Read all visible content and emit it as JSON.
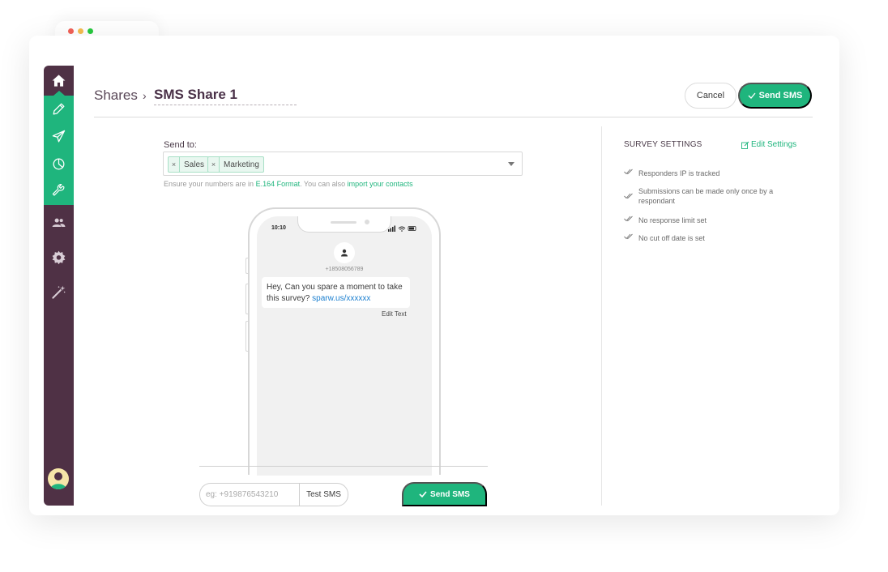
{
  "header": {
    "breadcrumb_root": "Shares",
    "breadcrumb_sep": "›",
    "title": "SMS Share 1",
    "cancel_label": "Cancel",
    "send_label": "Send SMS"
  },
  "sidebar": {
    "items": [
      {
        "name": "home",
        "icon": "home-icon"
      },
      {
        "name": "edit",
        "icon": "pencil-icon"
      },
      {
        "name": "share",
        "icon": "paper-plane-icon"
      },
      {
        "name": "reports",
        "icon": "pie-chart-icon"
      },
      {
        "name": "integrations",
        "icon": "wrench-icon"
      },
      {
        "name": "users",
        "icon": "users-icon"
      },
      {
        "name": "settings",
        "icon": "gear-icon"
      },
      {
        "name": "magic",
        "icon": "magic-wand-icon"
      }
    ],
    "active_color": "#1fb57d",
    "bg_color": "#4f3145"
  },
  "send_to": {
    "label": "Send to:",
    "tags": [
      "Sales",
      "Marketing"
    ],
    "tag_remove": "×",
    "hint_prefix": "Ensure your numbers are in ",
    "hint_link1": "E.164 Format",
    "hint_mid": ". You can also ",
    "hint_link2": "import your contacts"
  },
  "phone": {
    "time": "10:10",
    "contact_number": "+18508056789",
    "message_text": "Hey, Can you spare a moment to take this survey? ",
    "message_link": "sparw.us/xxxxxx",
    "edit_text_label": "Edit Text"
  },
  "test": {
    "placeholder": "eg: +919876543210",
    "test_label": "Test SMS",
    "send_label": "Send SMS"
  },
  "settings": {
    "title": "SURVEY SETTINGS",
    "edit_label": "Edit Settings",
    "items": [
      "Responders IP is tracked",
      "Submissions can be made only once by a respondant",
      "No response limit set",
      "No cut off date is set"
    ]
  },
  "colors": {
    "accent": "#1fb57d",
    "link_blue": "#1b7fcf",
    "dot_red": "#f26157",
    "dot_yellow": "#f5bd4f",
    "dot_green": "#27c93f"
  }
}
